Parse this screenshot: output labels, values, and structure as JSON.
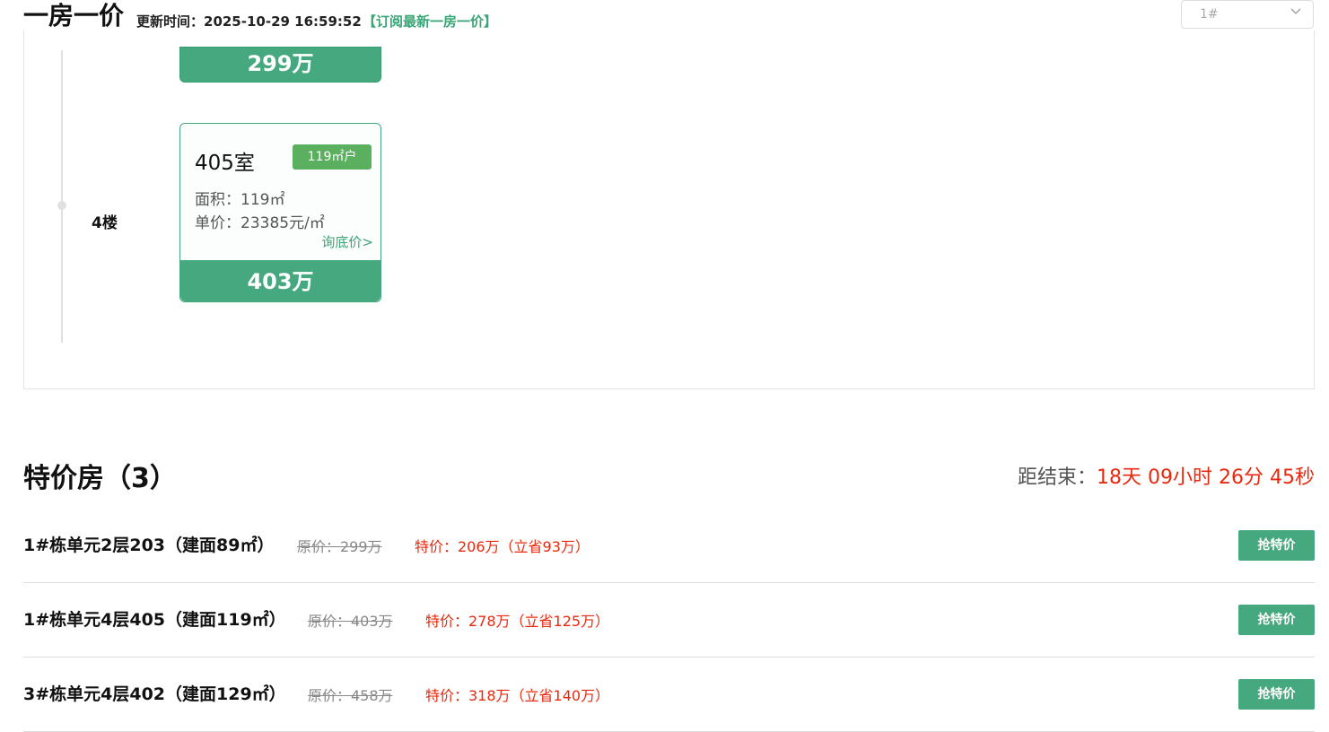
{
  "header": {
    "title": "一房一价",
    "update_label": "更新时间：2025-10-29 16:59:52",
    "subscribe_link": "【订阅最新一房一价】",
    "building_select": "1#"
  },
  "floors": {
    "prev_card_price": "299万",
    "floor_label": "4楼",
    "card": {
      "room": "405室",
      "badge": "119㎡户",
      "area": "面积：119㎡",
      "unit_price": "单价：23385元/㎡",
      "ask_link": "询底价>",
      "total_price": "403万"
    }
  },
  "specials": {
    "title": "特价房（3）",
    "countdown_label": "距结束：",
    "countdown_value": "18天 09小时 26分 45秒",
    "rows": [
      {
        "name": "1#栋单元2层203（建面89㎡）",
        "original": "原价：299万",
        "sale": "特价：206万（立省93万）",
        "button": "抢特价"
      },
      {
        "name": "1#栋单元4层405（建面119㎡）",
        "original": "原价：403万",
        "sale": "特价：278万（立省125万）",
        "button": "抢特价"
      },
      {
        "name": "3#栋单元4层402（建面129㎡）",
        "original": "原价：458万",
        "sale": "特价：318万（立省140万）",
        "button": "抢特价"
      }
    ]
  },
  "colors": {
    "accent": "#45a87f",
    "badge": "#5bb05f",
    "sale_red": "#e8290f"
  }
}
